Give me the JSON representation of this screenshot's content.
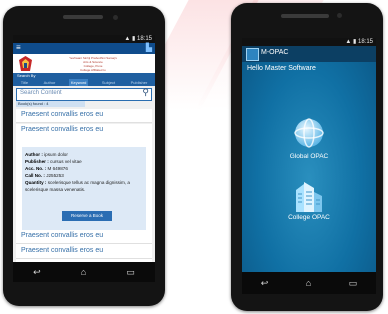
{
  "colors": {
    "left_header": "#0f4c8c",
    "left_accent": "#1f5fa0",
    "right_bg": "#1070a4",
    "right_appbar": "#0c3f63"
  },
  "left": {
    "status_time": "18:15",
    "institution_lines": [
      "Yeshwant Sinhji Prabodhini Samaj's",
      "Arts & Science",
      "College, Pune",
      "College Affiliated to"
    ],
    "search_by_label": "Search By",
    "tabs": [
      "Title",
      "Author",
      "Keyword",
      "Subject",
      "Publisher"
    ],
    "search_placeholder": "Search Content",
    "results_found": "Book(s) found : 4",
    "results": [
      {
        "title": "Praesent convallis eros eu"
      },
      {
        "title": "Praesent convallis eros eu"
      },
      {
        "title": "Praesent convallis eros eu"
      }
    ],
    "detail": {
      "title": "Praesent convallis eros eu",
      "author_label": "Author :",
      "author": "ipsum dolor",
      "publisher_label": "Publisher :",
      "publisher": "cursus vel vitae",
      "acc_label": "Acc. No. :",
      "acc": "M 649876",
      "call_label": "Call No. :",
      "call": "J255253",
      "quantity_label": "Quantity :",
      "quantity_lines": [
        "scelerisque tellus ac magna dignissim, a",
        "scelerisque massa venenatis."
      ],
      "button": "Reserve a Book"
    },
    "icons": {
      "back": "back-arrow-icon",
      "home": "home-icon",
      "recent": "recent-apps-icon"
    }
  },
  "right": {
    "status_time": "18:15",
    "app_name": "M-OPAC",
    "greeting": "Hello Master Software",
    "global_label": "Global OPAC",
    "college_label": "College OPAC"
  }
}
